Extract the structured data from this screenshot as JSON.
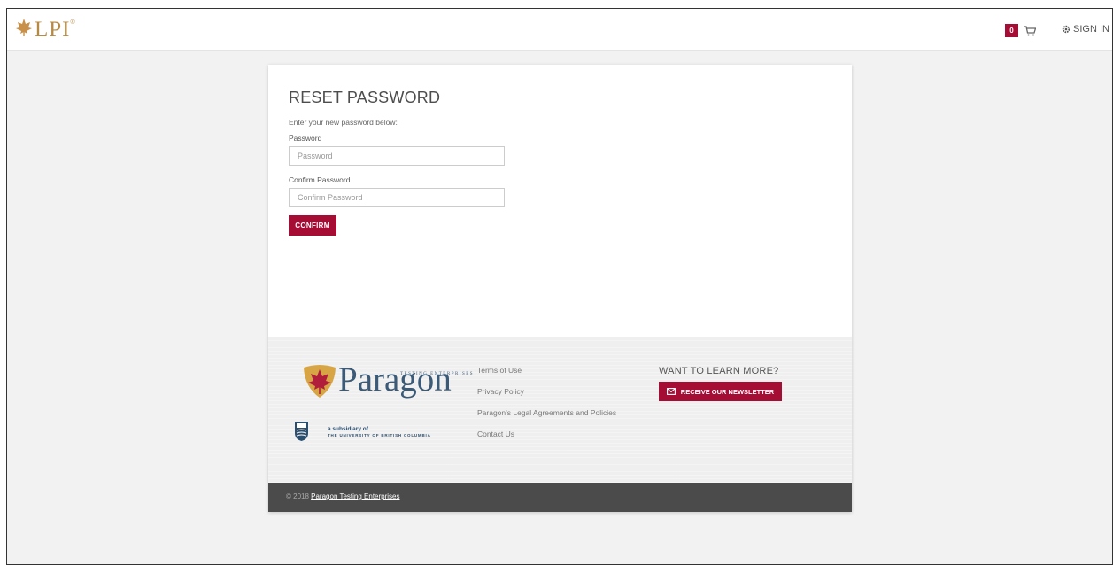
{
  "header": {
    "logo_text": "LPI",
    "logo_reg": "®",
    "cart_count": "0",
    "signin_label": "SIGN IN"
  },
  "form": {
    "title": "RESET PASSWORD",
    "instruction": "Enter your new password below:",
    "password_label": "Password",
    "password_placeholder": "Password",
    "confirm_label": "Confirm Password",
    "confirm_placeholder": "Confirm Password",
    "confirm_button": "CONFIRM"
  },
  "footer": {
    "paragon_word": "Paragon",
    "paragon_tagline": "TESTING ENTERPRISES",
    "ubc_line1": "a subsidiary of",
    "ubc_line2": "THE UNIVERSITY OF BRITISH COLUMBIA",
    "links": [
      "Terms of Use",
      "Privacy Policy",
      "Paragon's Legal Agreements and Policies",
      "Contact Us"
    ],
    "learn_title": "WANT TO LEARN MORE?",
    "newsletter_button": "RECEIVE OUR NEWSLETTER",
    "copyright_prefix": "© 2018",
    "copyright_link": "Paragon Testing Enterprises"
  },
  "colors": {
    "accent": "#a50d35",
    "logo_gold": "#b58a45",
    "paragon_blue": "#3a5a78",
    "footer_bar": "#4b4b4b"
  }
}
